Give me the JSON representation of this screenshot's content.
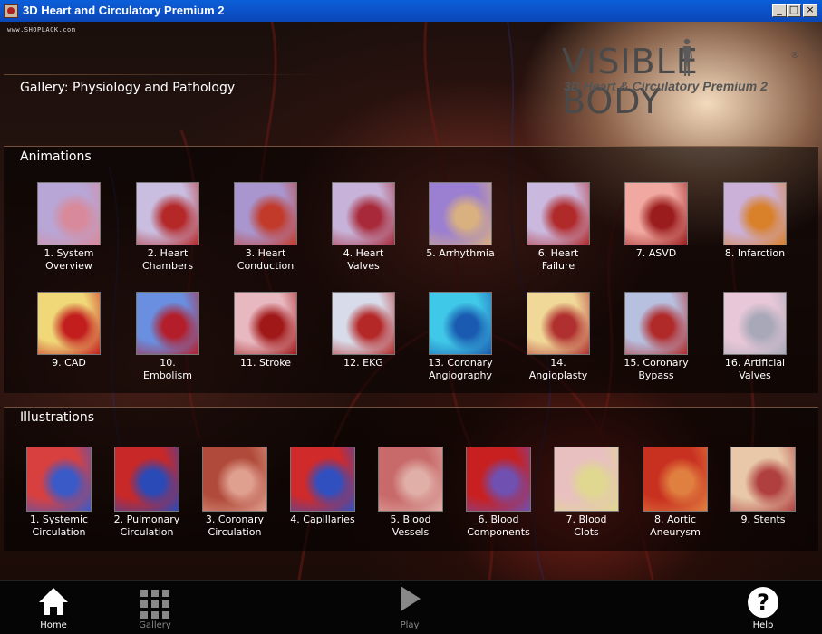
{
  "window": {
    "title": "3D Heart and Circulatory Premium 2",
    "controls": {
      "minimize": "_",
      "maximize": "□",
      "close": "×"
    }
  },
  "watermark": "www.SHOPLACK.com",
  "logo": {
    "main": "VISIBLE BODY",
    "registered": "®",
    "subtitle": "3D Heart & Circulatory Premium 2"
  },
  "header": {
    "gallery_title": "Gallery: Physiology and Pathology"
  },
  "animations": {
    "title": "Animations",
    "items": [
      {
        "label": "1. System\nOverview",
        "c1": "#b8a6d6",
        "c2": "#d88a9a"
      },
      {
        "label": "2. Heart\nChambers",
        "c1": "#c9bde0",
        "c2": "#b42828"
      },
      {
        "label": "3. Heart\nConduction",
        "c1": "#a996cf",
        "c2": "#c23a2a"
      },
      {
        "label": "4. Heart\nValves",
        "c1": "#c7b3d9",
        "c2": "#a82a3a"
      },
      {
        "label": "5. Arrhythmia",
        "c1": "#9b7fd0",
        "c2": "#d9b080"
      },
      {
        "label": "6. Heart\nFailure",
        "c1": "#cbb8de",
        "c2": "#b02a2a"
      },
      {
        "label": "7. ASVD",
        "c1": "#f0a8a0",
        "c2": "#9a1c1c"
      },
      {
        "label": "8. Infarction",
        "c1": "#cbb0d8",
        "c2": "#d9802a"
      },
      {
        "label": "9. CAD",
        "c1": "#f0d878",
        "c2": "#c21e1e"
      },
      {
        "label": "10.\nEmbolism",
        "c1": "#6a8ee0",
        "c2": "#b41e2a"
      },
      {
        "label": "11. Stroke",
        "c1": "#e8b8c0",
        "c2": "#a01818"
      },
      {
        "label": "12. EKG",
        "c1": "#d8dcea",
        "c2": "#b42828"
      },
      {
        "label": "13. Coronary\nAngiography",
        "c1": "#40c8e8",
        "c2": "#1a5ab0"
      },
      {
        "label": "14.\nAngioplasty",
        "c1": "#f0d898",
        "c2": "#b03030"
      },
      {
        "label": "15. Coronary\nBypass",
        "c1": "#b8c0e0",
        "c2": "#b02a2a"
      },
      {
        "label": "16. Artificial\nValves",
        "c1": "#e8c8d8",
        "c2": "#a8a8b8"
      }
    ]
  },
  "illustrations": {
    "title": "Illustrations",
    "items": [
      {
        "label": "1. Systemic\nCirculation",
        "c1": "#d84040",
        "c2": "#3a5ac8"
      },
      {
        "label": "2. Pulmonary\nCirculation",
        "c1": "#c82828",
        "c2": "#2a4ab8"
      },
      {
        "label": "3. Coronary\nCirculation",
        "c1": "#b04a3a",
        "c2": "#e0a090"
      },
      {
        "label": "4. Capillaries",
        "c1": "#d02a2a",
        "c2": "#3050c0"
      },
      {
        "label": "5. Blood\nVessels",
        "c1": "#c86a6a",
        "c2": "#e0b0a8"
      },
      {
        "label": "6. Blood\nComponents",
        "c1": "#c82020",
        "c2": "#7050b0"
      },
      {
        "label": "7. Blood\nClots",
        "c1": "#e8c0c0",
        "c2": "#e0d890"
      },
      {
        "label": "8. Aortic\nAneurysm",
        "c1": "#c83020",
        "c2": "#e08040"
      },
      {
        "label": "9. Stents",
        "c1": "#e8c8a8",
        "c2": "#b04040"
      }
    ]
  },
  "bottom_bar": {
    "home": {
      "label": "Home",
      "icon": "home-icon"
    },
    "gallery": {
      "label": "Gallery",
      "icon": "grid-icon"
    },
    "play": {
      "label": "Play",
      "icon": "play-icon"
    },
    "help": {
      "label": "Help",
      "icon": "help-icon"
    }
  }
}
